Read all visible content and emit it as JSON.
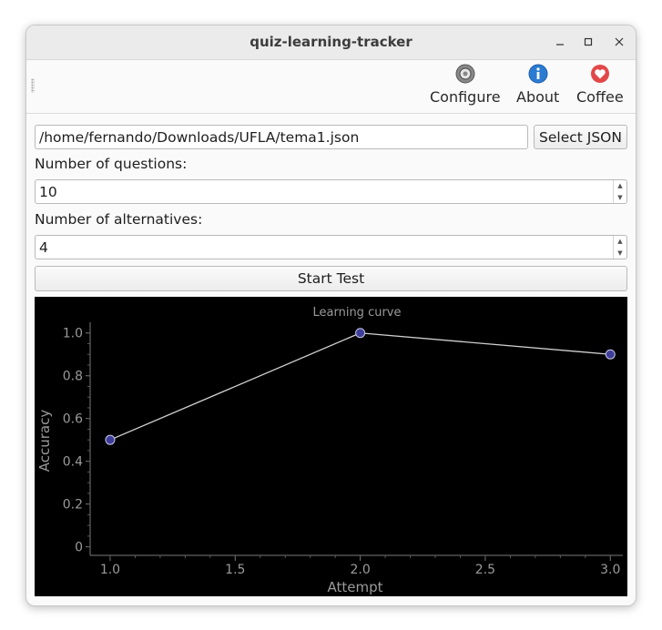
{
  "window": {
    "title": "quiz-learning-tracker"
  },
  "toolbar": {
    "configure_label": "Configure",
    "about_label": "About",
    "coffee_label": "Coffee"
  },
  "file": {
    "path": "/home/fernando/Downloads/UFLA/tema1.json",
    "select_label": "Select JSON"
  },
  "questions": {
    "label": "Number of questions:",
    "value": "10"
  },
  "alternatives": {
    "label": "Number of alternatives:",
    "value": "4"
  },
  "start_label": "Start Test",
  "colors": {
    "plot_bg": "#000000",
    "point_fill": "#3e3e9a",
    "line": "#d0d0d0",
    "text": "#9a9a9a"
  },
  "chart_data": {
    "type": "line",
    "title": "Learning curve",
    "xlabel": "Attempt",
    "ylabel": "Accuracy",
    "x": [
      1.0,
      2.0,
      3.0
    ],
    "y": [
      0.5,
      1.0,
      0.9
    ],
    "xlim": [
      0.92,
      3.05
    ],
    "ylim": [
      -0.04,
      1.05
    ],
    "xticks": [
      "1.0",
      "1.5",
      "2.0",
      "2.5",
      "3.0"
    ],
    "yticks": [
      "0",
      "0.2",
      "0.4",
      "0.6",
      "0.8",
      "1.0"
    ],
    "grid": false
  }
}
